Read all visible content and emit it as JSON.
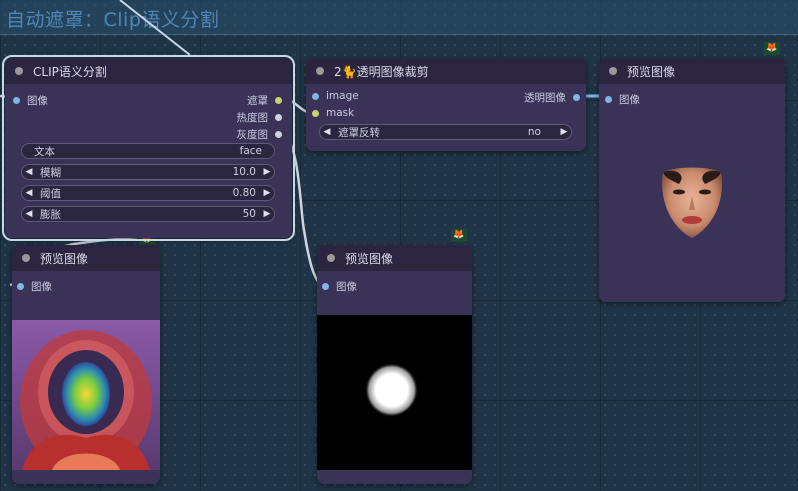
{
  "group": {
    "title": "自动遮罩：Clip语义分割"
  },
  "badge_icon": "fox-icon",
  "clip_node": {
    "title": "CLIP语义分割",
    "input_image": "图像",
    "out_mask": "遮罩",
    "out_heatmap": "热度图",
    "out_gray": "灰度图",
    "text_label": "文本",
    "text_value": "face",
    "blur_label": "模糊",
    "blur_value": "10.0",
    "threshold_label": "阈值",
    "threshold_value": "0.80",
    "dilate_label": "膨胀",
    "dilate_value": "50"
  },
  "crop_node": {
    "title": "2🐈透明图像裁剪",
    "input_image": "image",
    "input_mask": "mask",
    "out_transparent": "透明图像",
    "invert_label": "遮罩反转",
    "invert_value": "no"
  },
  "preview_right": {
    "title": "预览图像",
    "input_image": "图像"
  },
  "preview_left": {
    "title": "预览图像",
    "input_image": "图像"
  },
  "preview_mid": {
    "title": "预览图像",
    "input_image": "图像"
  },
  "colors": {
    "canvas": "#1f3446",
    "node_body": "#3a3357",
    "node_title": "#2b2540",
    "group_title": "#4f86b8",
    "port_image": "#7fb6e8",
    "port_mask": "#c8d36a"
  }
}
